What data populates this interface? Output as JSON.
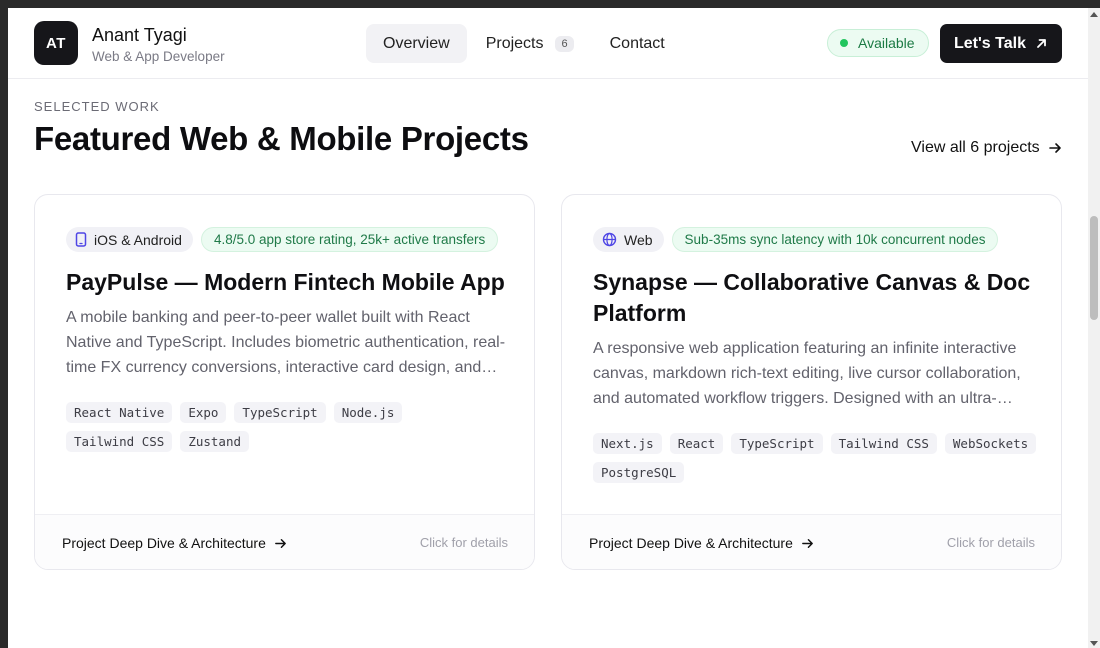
{
  "header": {
    "avatar_initials": "AT",
    "name": "Anant Tyagi",
    "role": "Web & App Developer",
    "nav": [
      {
        "label": "Overview",
        "active": true
      },
      {
        "label": "Projects",
        "badge": "6"
      },
      {
        "label": "Contact"
      }
    ],
    "status": "Available",
    "cta": "Let's Talk"
  },
  "section": {
    "eyebrow": "SELECTED WORK",
    "title": "Featured Web & Mobile Projects",
    "view_all": "View all 6 projects"
  },
  "projects": [
    {
      "platform": "iOS & Android",
      "platform_icon": "phone-icon",
      "metric": "4.8/5.0 app store rating, 25k+ active transfers",
      "title": "PayPulse — Modern Fintech Mobile App",
      "description": "A mobile banking and peer-to-peer wallet built with React Native and TypeScript. Includes biometric authentication, real-time FX currency conversions, interactive card design, and end-to-end encrypted transaction history.",
      "tech": [
        "React Native",
        "Expo",
        "TypeScript",
        "Node.js",
        "Tailwind CSS",
        "Zustand"
      ],
      "footer_link": "Project Deep Dive & Architecture",
      "footer_hint": "Click for details"
    },
    {
      "platform": "Web",
      "platform_icon": "globe-icon",
      "metric": "Sub-35ms sync latency with 10k concurrent nodes",
      "title": "Synapse — Collaborative Canvas & Doc Platform",
      "description": "A responsive web application featuring an infinite interactive canvas, markdown rich-text editing, live cursor collaboration, and automated workflow triggers. Designed with an ultra-clean minimal interface.",
      "tech": [
        "Next.js",
        "React",
        "TypeScript",
        "Tailwind CSS",
        "WebSockets",
        "PostgreSQL"
      ],
      "footer_link": "Project Deep Dive & Architecture",
      "footer_hint": "Click for details"
    }
  ],
  "colors": {
    "accent_dark": "#16161a",
    "status_green": "#22c55e",
    "icon_blue": "#4f46e5"
  }
}
